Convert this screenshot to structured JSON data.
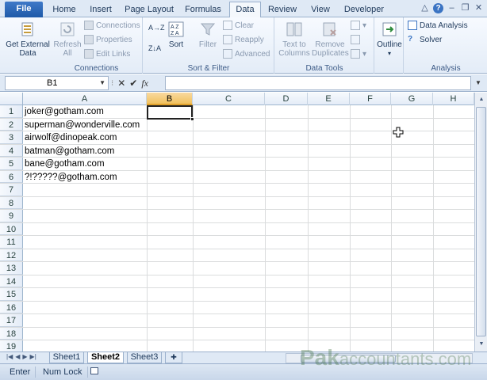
{
  "tabs": {
    "file": "File",
    "home": "Home",
    "insert": "Insert",
    "page_layout": "Page Layout",
    "formulas": "Formulas",
    "data": "Data",
    "review": "Review",
    "view": "View",
    "developer": "Developer"
  },
  "ribbon": {
    "get_external_data": "Get External Data",
    "refresh_all": "Refresh All",
    "connections": "Connections",
    "properties": "Properties",
    "edit_links": "Edit Links",
    "group_connections": "Connections",
    "sort_az": "A→Z",
    "sort": "Sort",
    "filter": "Filter",
    "clear": "Clear",
    "reapply": "Reapply",
    "advanced": "Advanced",
    "group_sort_filter": "Sort & Filter",
    "text_to_columns": "Text to Columns",
    "remove_duplicates": "Remove Duplicates",
    "group_data_tools": "Data Tools",
    "outline": "Outline",
    "data_analysis": "Data Analysis",
    "solver": "Solver",
    "group_analysis": "Analysis"
  },
  "formula_bar": {
    "name_box": "B1",
    "cancel": "✕",
    "enter": "✔",
    "fx": "fx",
    "formula": ""
  },
  "columns": [
    "A",
    "B",
    "C",
    "D",
    "E",
    "F",
    "G",
    "H"
  ],
  "rows": [
    {
      "n": "1",
      "a": "joker@gotham.com"
    },
    {
      "n": "2",
      "a": "superman@wonderville.com"
    },
    {
      "n": "3",
      "a": "airwolf@dinopeak.com"
    },
    {
      "n": "4",
      "a": "batman@gotham.com"
    },
    {
      "n": "5",
      "a": "bane@gotham.com"
    },
    {
      "n": "6",
      "a": "?!?????@gotham.com"
    },
    {
      "n": "7",
      "a": ""
    },
    {
      "n": "8",
      "a": ""
    },
    {
      "n": "9",
      "a": ""
    },
    {
      "n": "10",
      "a": ""
    },
    {
      "n": "11",
      "a": ""
    },
    {
      "n": "12",
      "a": ""
    },
    {
      "n": "13",
      "a": ""
    },
    {
      "n": "14",
      "a": ""
    },
    {
      "n": "15",
      "a": ""
    },
    {
      "n": "16",
      "a": ""
    },
    {
      "n": "17",
      "a": ""
    },
    {
      "n": "18",
      "a": ""
    },
    {
      "n": "19",
      "a": ""
    }
  ],
  "sheets": [
    "Sheet1",
    "Sheet2",
    "Sheet3"
  ],
  "active_sheet": "Sheet2",
  "status": {
    "mode": "Enter",
    "num_lock": "Num Lock"
  },
  "watermark": {
    "brand": "Pak",
    "rest": "accountants.com"
  },
  "colors": {
    "file_tab": "#2a66b8",
    "selected_header": "#f1c15f",
    "gridline": "#dadcdd"
  }
}
